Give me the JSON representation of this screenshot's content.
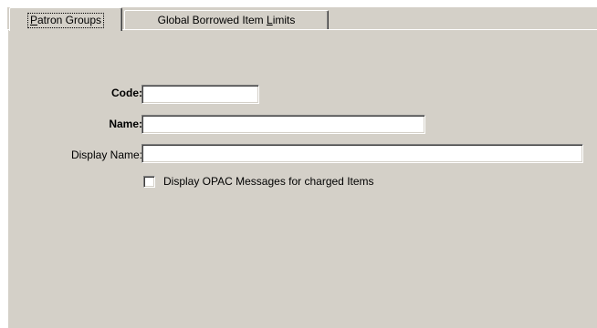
{
  "tabs": [
    {
      "label_pre": "",
      "mnemonic": "P",
      "label_post": "atron Groups",
      "active": true
    },
    {
      "label_pre": "Global Borrowed Item ",
      "mnemonic": "L",
      "label_post": "imits",
      "active": false
    }
  ],
  "form": {
    "code": {
      "label": "Code:",
      "value": ""
    },
    "name": {
      "label": "Name:",
      "value": ""
    },
    "display_name": {
      "label": "Display Name:",
      "value": ""
    },
    "opac_checkbox": {
      "label": "Display OPAC Messages for charged Items",
      "checked": false
    }
  },
  "colors": {
    "panel": "#d4d0c8",
    "field": "#ffffff"
  }
}
